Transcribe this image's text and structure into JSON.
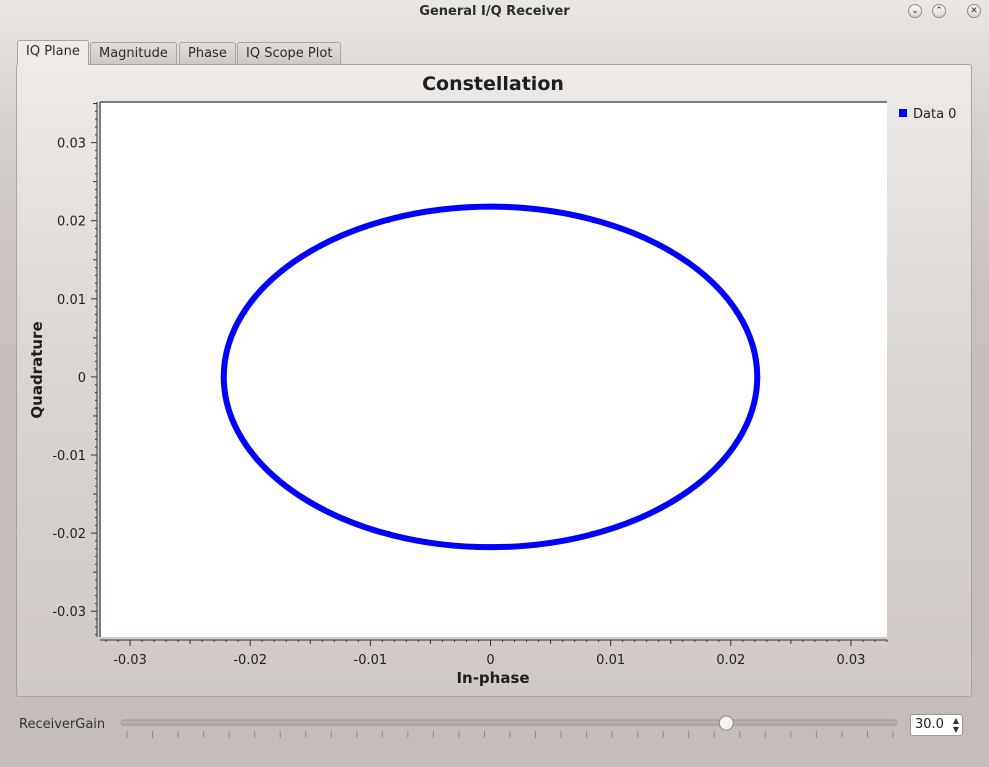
{
  "window": {
    "title": "General I/Q Receiver"
  },
  "tabs": [
    {
      "label": "IQ Plane",
      "active": true
    },
    {
      "label": "Magnitude",
      "active": false
    },
    {
      "label": "Phase",
      "active": false
    },
    {
      "label": "IQ Scope Plot",
      "active": false
    }
  ],
  "chart_data": {
    "type": "scatter",
    "title": "Constellation",
    "xlabel": "In-phase",
    "ylabel": "Quadrature",
    "xlim": [
      -0.0325,
      0.033
    ],
    "ylim": [
      -0.0333,
      0.0352
    ],
    "xticks": [
      "-0.03",
      "-0.02",
      "-0.01",
      "0",
      "0.01",
      "0.02",
      "0.03"
    ],
    "yticks": [
      "0.03",
      "0.02",
      "0.01",
      "0",
      "-0.01",
      "-0.02",
      "-0.03"
    ],
    "legend": {
      "placement": "top-right",
      "entries": [
        "Data 0"
      ]
    },
    "grid": false,
    "series": [
      {
        "name": "Data 0",
        "color": "#0000ff",
        "shape": "circle",
        "center": [
          0.0,
          0.0
        ],
        "radius_x": 0.0222,
        "radius_y": 0.0218,
        "points": [
          [
            0.0222,
            0.0
          ],
          [
            0.0205,
            0.0083
          ],
          [
            0.0157,
            0.0154
          ],
          [
            0.0085,
            0.0201
          ],
          [
            0.0,
            0.0218
          ],
          [
            -0.0085,
            0.0201
          ],
          [
            -0.0157,
            0.0154
          ],
          [
            -0.0205,
            0.0083
          ],
          [
            -0.0222,
            0.0
          ],
          [
            -0.0205,
            -0.0083
          ],
          [
            -0.0157,
            -0.0154
          ],
          [
            -0.0085,
            -0.0201
          ],
          [
            0.0,
            -0.0218
          ],
          [
            0.0085,
            -0.0201
          ],
          [
            0.0157,
            -0.0154
          ],
          [
            0.0205,
            -0.0083
          ]
        ]
      }
    ]
  },
  "controls": {
    "gain_label": "ReceiverGain",
    "gain_value": "30.0",
    "gain_slider_fraction": 0.78
  }
}
